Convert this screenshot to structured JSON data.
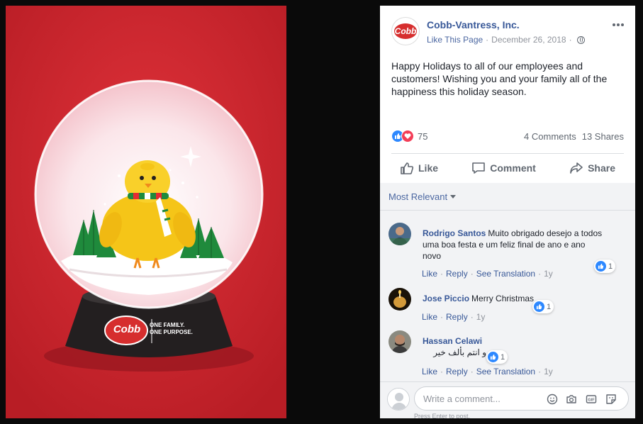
{
  "post": {
    "page_name": "Cobb-Vantress, Inc.",
    "like_page": "Like This Page",
    "separator": "·",
    "date": "December 26, 2018",
    "more_icon": "more-horizontal-icon",
    "text": "Happy Holidays to all of our employees and customers! Wishing you and your family all of the happiness this holiday season.",
    "avatar_text": "Cobb"
  },
  "photo": {
    "logo_text": "Cobb",
    "tagline_1": "ONE FAMILY.",
    "tagline_2": "ONE PURPOSE."
  },
  "stats": {
    "reaction_count": "75",
    "comments": "4 Comments",
    "shares": "13 Shares"
  },
  "actions": {
    "like": "Like",
    "comment": "Comment",
    "share": "Share"
  },
  "filter": {
    "label": "Most Relevant"
  },
  "comments": [
    {
      "author": "Rodrigo Santos",
      "text": "Muito obrigado desejo a todos uma boa festa e um feliz final de ano e ano novo",
      "like": "Like",
      "reply": "Reply",
      "translate": "See Translation",
      "time": "1y",
      "reactions": "1"
    },
    {
      "author": "Jose Piccio",
      "text": "Merry Christmas",
      "like": "Like",
      "reply": "Reply",
      "time": "1y",
      "reactions": "1"
    },
    {
      "author": "Hassan Celawi",
      "text": "و انتم بألف خير",
      "like": "Like",
      "reply": "Reply",
      "translate": "See Translation",
      "time": "1y",
      "reactions": "1"
    }
  ],
  "composer": {
    "placeholder": "Write a comment...",
    "hint": "Press Enter to post."
  },
  "colors": {
    "brand_blue": "#385898",
    "photo_red": "#c42128",
    "like_blue": "#2d88ff",
    "love_red": "#f33e58"
  }
}
